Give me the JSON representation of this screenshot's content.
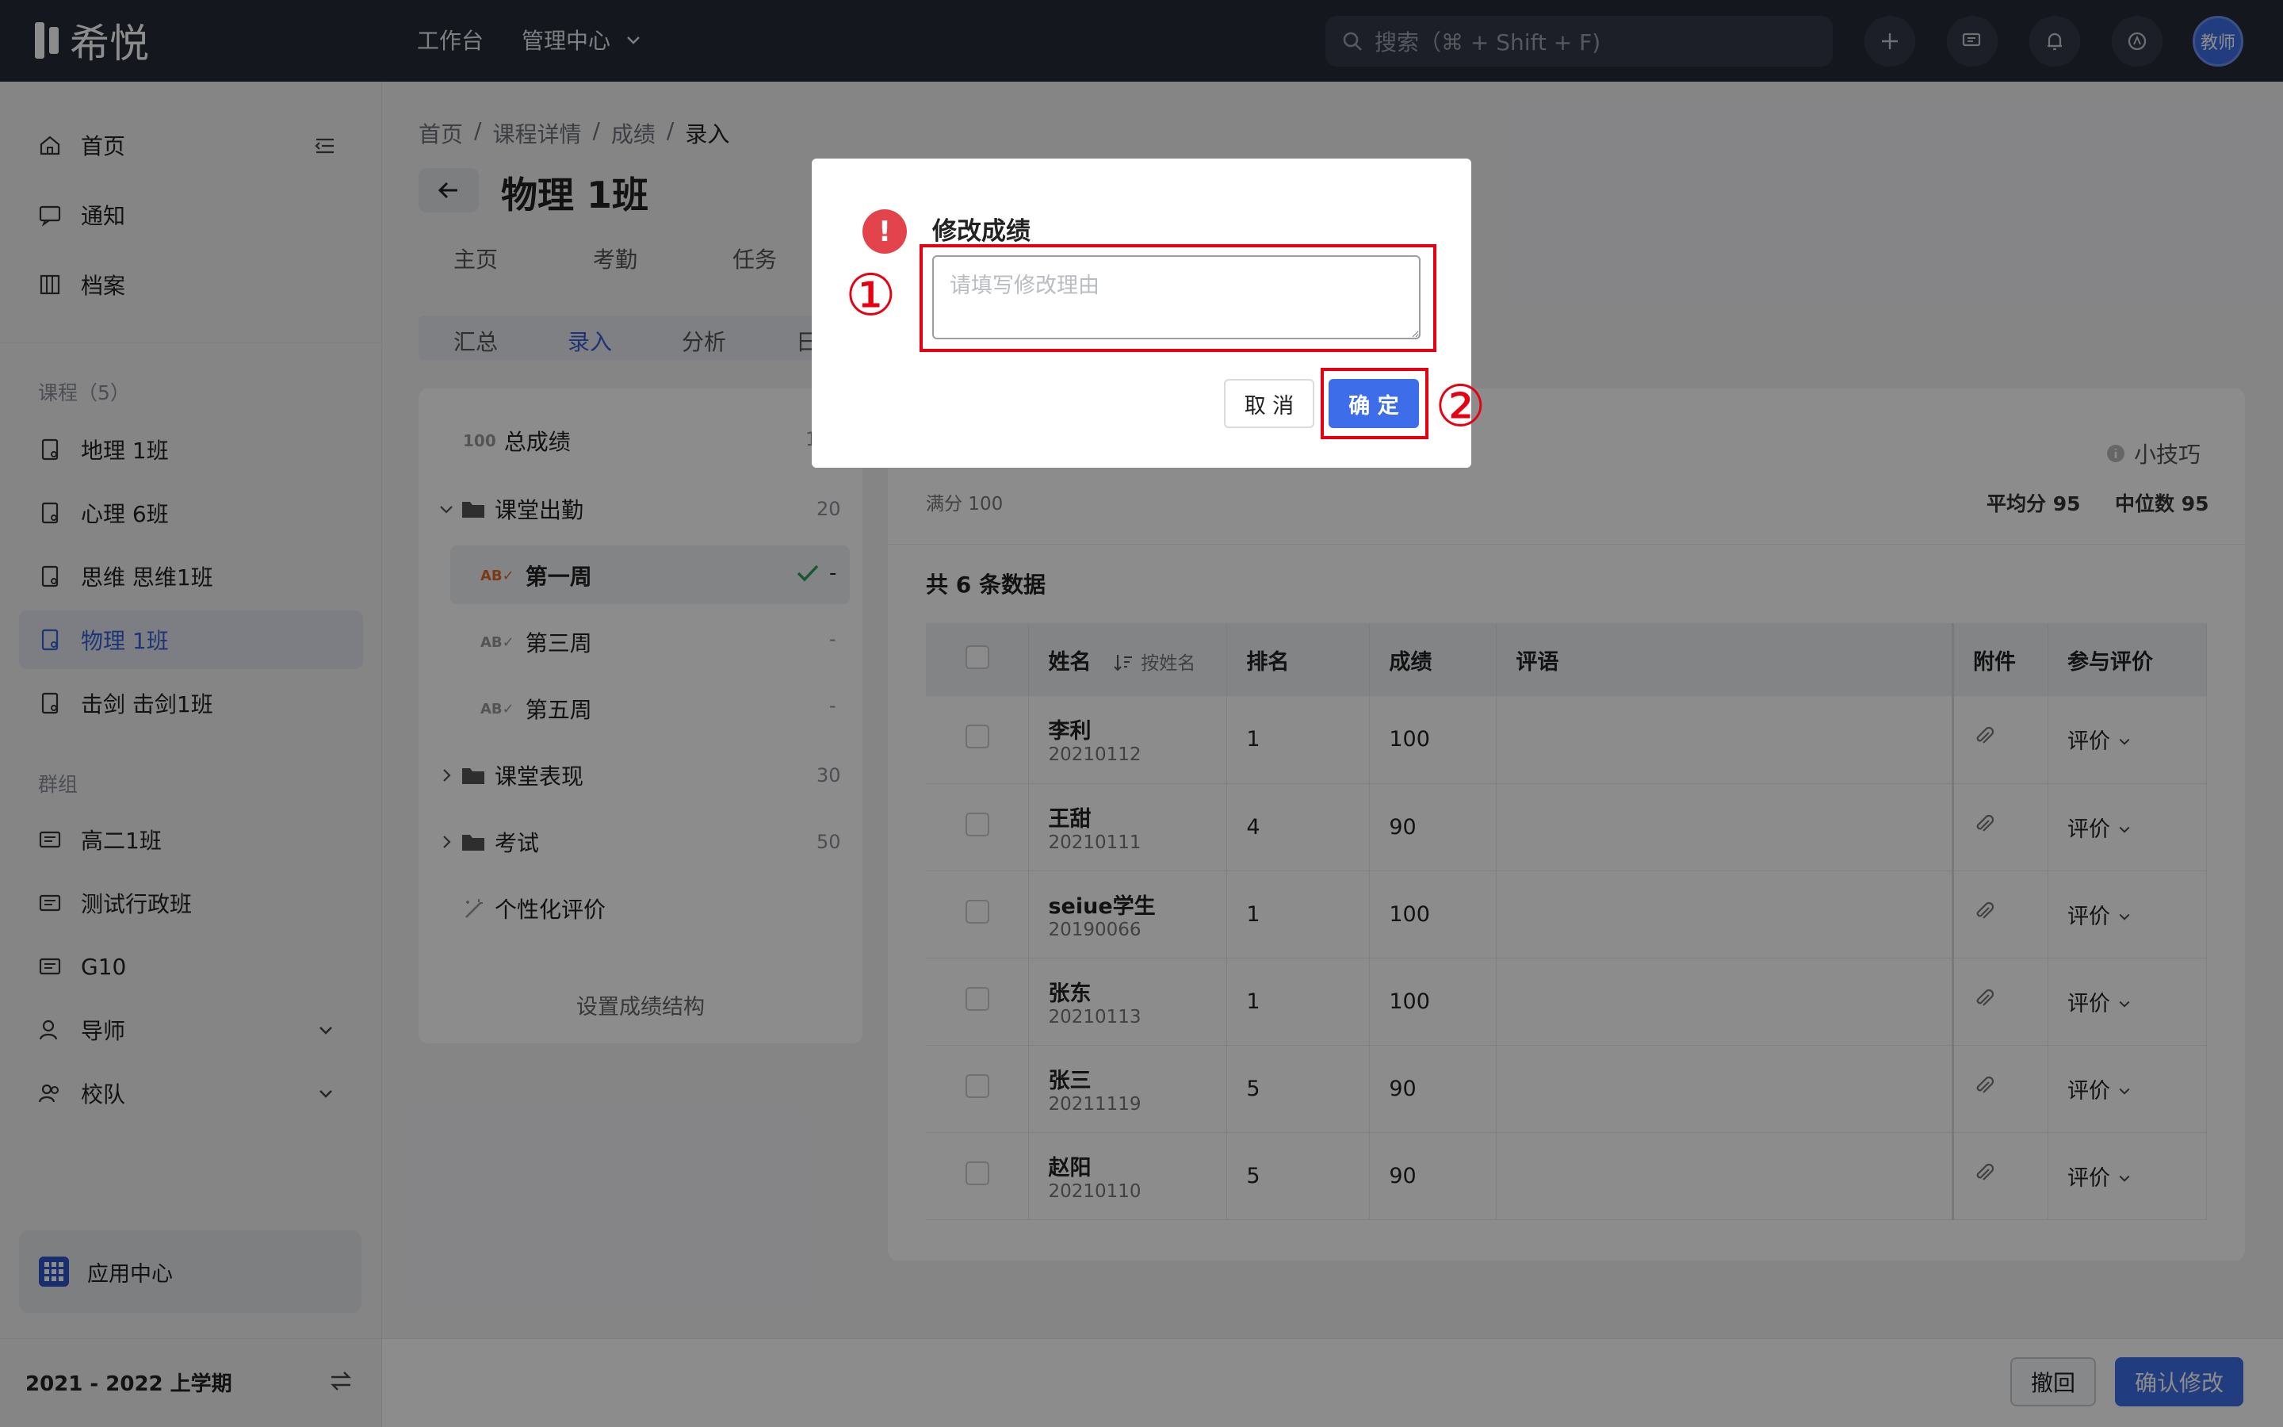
{
  "app": {
    "logo_text": "希悦"
  },
  "topbar": {
    "nav": [
      "工作台",
      "管理中心"
    ],
    "search_placeholder": "搜索（⌘ + Shift + F)",
    "avatar_text": "教师"
  },
  "sidebar": {
    "main_items": [
      "首页",
      "通知",
      "档案"
    ],
    "courses_label": "课程（5）",
    "courses": [
      "地理 1班",
      "心理 6班",
      "思维 思维1班",
      "物理 1班",
      "击剑 击剑1班"
    ],
    "groups_label": "群组",
    "groups": [
      "高二1班",
      "测试行政班",
      "G10",
      "导师",
      "校队"
    ],
    "app_center": "应用中心",
    "term": "2021 - 2022 上学期"
  },
  "main": {
    "breadcrumb": [
      "首页",
      "课程详情",
      "成绩",
      "录入"
    ],
    "title": "物理 1班",
    "tabs": [
      "主页",
      "考勤",
      "任务"
    ],
    "subtabs": [
      "汇总",
      "录入",
      "分析",
      "日"
    ],
    "tree": {
      "total_label": "总成绩",
      "total_num": "1",
      "attendance_label": "课堂出勤",
      "attendance_num": "20",
      "weeks": [
        {
          "label": "第一周",
          "value": "-"
        },
        {
          "label": "第三周",
          "value": "-"
        },
        {
          "label": "第五周",
          "value": "-"
        }
      ],
      "performance_label": "课堂表现",
      "performance_num": "30",
      "exam_label": "考试",
      "exam_num": "50",
      "personal_label": "个性化评价",
      "set_structure": "设置成绩结构"
    },
    "right": {
      "tips": "小技巧",
      "full_score": "满分 100",
      "average": "平均分 95",
      "median": "中位数 95",
      "count_text": "共 6 条数据",
      "headers": [
        "姓名",
        "按姓名",
        "排名",
        "成绩",
        "评语",
        "附件",
        "参与评价"
      ],
      "rows": [
        {
          "name": "李利",
          "id": "20210112",
          "rank": "1",
          "score": "100",
          "eval": "评价"
        },
        {
          "name": "王甜",
          "id": "20210111",
          "rank": "4",
          "score": "90",
          "eval": "评价"
        },
        {
          "name": "seiue学生",
          "id": "20190066",
          "rank": "1",
          "score": "100",
          "eval": "评价"
        },
        {
          "name": "张东",
          "id": "20210113",
          "rank": "1",
          "score": "100",
          "eval": "评价"
        },
        {
          "name": "张三",
          "id": "20211119",
          "rank": "5",
          "score": "90",
          "eval": "评价"
        },
        {
          "name": "赵阳",
          "id": "20210110",
          "rank": "5",
          "score": "90",
          "eval": "评价"
        }
      ]
    },
    "bottom": {
      "undo": "撤回",
      "confirm": "确认修改"
    }
  },
  "modal": {
    "title": "修改成绩",
    "reason_placeholder": "请填写修改理由",
    "cancel": "取 消",
    "ok": "确 定"
  },
  "annotations": {
    "marker1": "①",
    "marker2": "②"
  },
  "colors": {
    "accent": "#3d6de8",
    "warning": "#e3434a",
    "highlight": "#e60012",
    "topbar": "#252a36"
  }
}
